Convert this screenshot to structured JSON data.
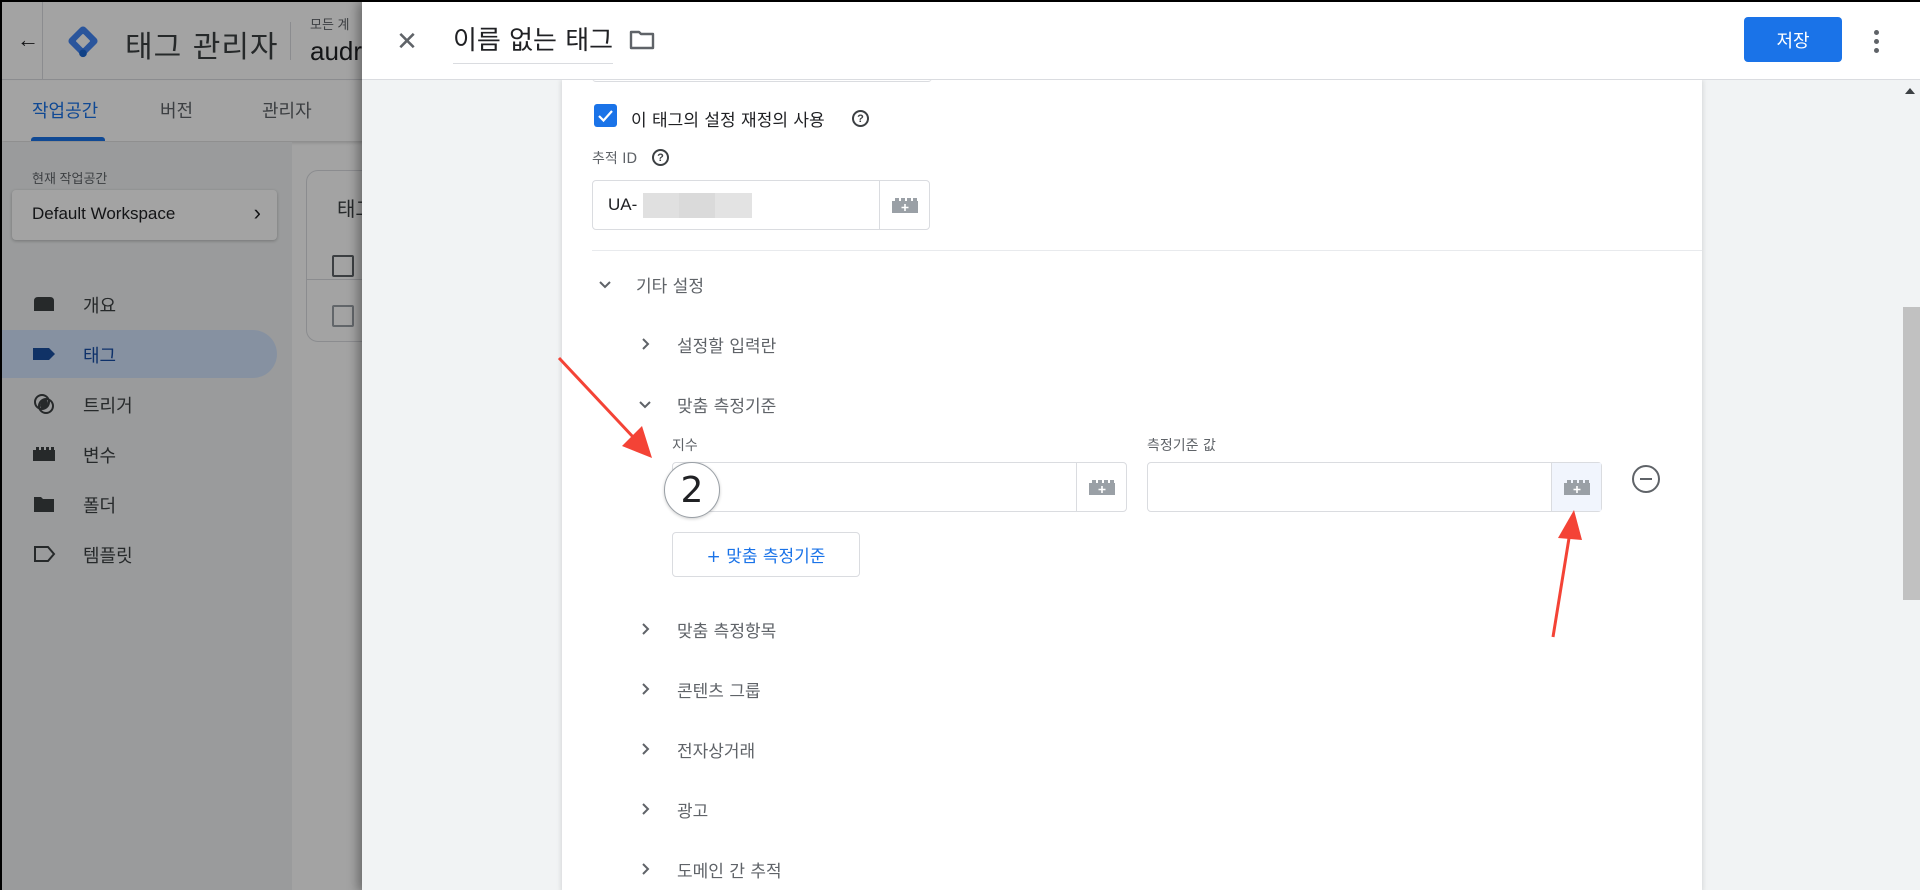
{
  "app": {
    "title": "태그 관리자",
    "account_label": "모든 계",
    "container_name": "audr",
    "back_icon": "arrow-left-icon",
    "logo": "gtm-logo-icon"
  },
  "tabs": [
    {
      "label": "작업공간",
      "active": true
    },
    {
      "label": "버전",
      "active": false
    },
    {
      "label": "관리자",
      "active": false
    }
  ],
  "sidebar": {
    "workspace_label": "현재 작업공간",
    "workspace_name": "Default Workspace",
    "items": [
      {
        "label": "개요",
        "icon": "overview-icon",
        "active": false
      },
      {
        "label": "태그",
        "icon": "tag-icon",
        "active": true
      },
      {
        "label": "트리거",
        "icon": "trigger-icon",
        "active": false
      },
      {
        "label": "변수",
        "icon": "variable-icon",
        "active": false
      },
      {
        "label": "폴더",
        "icon": "folder-icon",
        "active": false
      },
      {
        "label": "템플릿",
        "icon": "template-icon",
        "active": false
      }
    ]
  },
  "background_card": {
    "title": "태그"
  },
  "panel": {
    "close_icon": "close-icon",
    "tag_name": "이름 없는 태그",
    "folder_icon": "folder-outline-icon",
    "save_label": "저장",
    "more_icon": "more-vert-icon",
    "colors": {
      "accent": "#1a73e8",
      "annotation_arrow": "#f44336"
    }
  },
  "config": {
    "override_checkbox": {
      "label": "이 태그의 설정 재정의 사용",
      "checked": true
    },
    "tracking_id": {
      "label": "추적 ID",
      "value": "UA-"
    },
    "more_settings": {
      "label": "기타 설정",
      "expanded": true,
      "sections": [
        {
          "label": "설정할 입력란",
          "expanded": false
        },
        {
          "label": "맞춤 측정기준",
          "expanded": true
        },
        {
          "label": "맞춤 측정항목",
          "expanded": false
        },
        {
          "label": "콘텐츠 그룹",
          "expanded": false
        },
        {
          "label": "전자상거래",
          "expanded": false
        },
        {
          "label": "광고",
          "expanded": false
        },
        {
          "label": "도메인 간 추적",
          "expanded": false
        }
      ]
    },
    "custom_dimension": {
      "index_label": "지수",
      "index_value": "",
      "value_label": "측정기준 값",
      "value_value": "",
      "add_label": "+ 맞춤 측정기준"
    }
  },
  "annotations": {
    "step_badge": "2"
  }
}
